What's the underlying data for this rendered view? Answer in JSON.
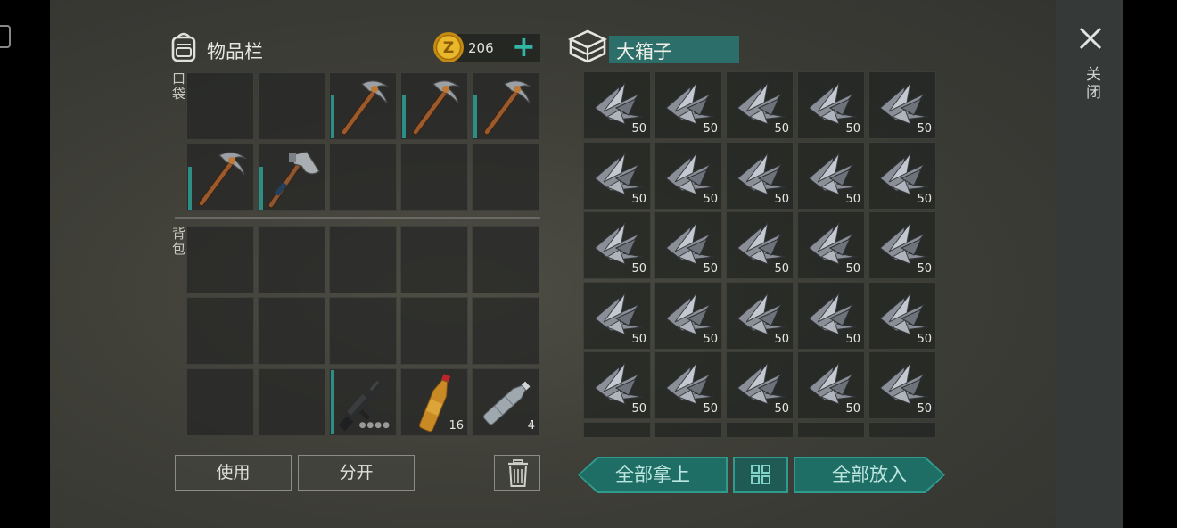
{
  "inventory": {
    "title": "物品栏",
    "coins": "206",
    "pocket_label": "口袋",
    "backpack_label": "背包",
    "pocket_slots": [
      {
        "item": "",
        "qty": ""
      },
      {
        "item": "",
        "qty": ""
      },
      {
        "item": "pickaxe",
        "qty": ""
      },
      {
        "item": "pickaxe",
        "qty": ""
      },
      {
        "item": "pickaxe",
        "qty": ""
      },
      {
        "item": "pickaxe",
        "qty": ""
      },
      {
        "item": "hatchet",
        "qty": ""
      },
      {
        "item": "",
        "qty": ""
      },
      {
        "item": "",
        "qty": ""
      },
      {
        "item": "",
        "qty": ""
      }
    ],
    "backpack_slots": [
      {
        "item": "",
        "qty": ""
      },
      {
        "item": "",
        "qty": ""
      },
      {
        "item": "",
        "qty": ""
      },
      {
        "item": "",
        "qty": ""
      },
      {
        "item": "",
        "qty": ""
      },
      {
        "item": "",
        "qty": ""
      },
      {
        "item": "",
        "qty": ""
      },
      {
        "item": "",
        "qty": ""
      },
      {
        "item": "",
        "qty": ""
      },
      {
        "item": "",
        "qty": ""
      },
      {
        "item": "",
        "qty": ""
      },
      {
        "item": "",
        "qty": ""
      },
      {
        "item": "rifle",
        "qty": ""
      },
      {
        "item": "soda-bottle",
        "qty": "16"
      },
      {
        "item": "water-bottle",
        "qty": "4"
      }
    ],
    "use_label": "使用",
    "split_label": "分开"
  },
  "chest": {
    "name": "大箱子",
    "item": "steel-scrap",
    "qty_per_slot": "50",
    "visible_rows": 5,
    "columns": 5,
    "take_all_label": "全部拿上",
    "put_all_label": "全部放入"
  },
  "close_label": "关闭",
  "colors": {
    "accent": "#2f9b8f",
    "accent_dark": "#1f6e66",
    "durability": "#2b8f86"
  },
  "icons": [
    "backpack-icon",
    "coin-icon",
    "plus-icon",
    "crate-icon",
    "trash-icon",
    "grid-sort-icon",
    "close-icon"
  ]
}
